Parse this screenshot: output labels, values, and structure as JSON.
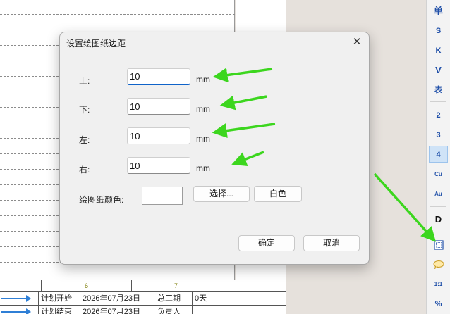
{
  "dialog": {
    "title": "设置绘图纸边距",
    "close_glyph": "✕",
    "margins": [
      {
        "label": "上:",
        "value": "10",
        "unit": "mm"
      },
      {
        "label": "下:",
        "value": "10",
        "unit": "mm"
      },
      {
        "label": "左:",
        "value": "10",
        "unit": "mm"
      },
      {
        "label": "右:",
        "value": "10",
        "unit": "mm"
      }
    ],
    "paper_color_label": "绘图纸颜色:",
    "paper_color_value": "#ffffff",
    "select_button": "选择...",
    "white_button": "白色",
    "ok_button": "确定",
    "cancel_button": "取消"
  },
  "gantt": {
    "column_numbers": [
      "6",
      "7"
    ],
    "rows": [
      {
        "label": "计划开始",
        "date": "2026年07月23日",
        "field": "总工期",
        "value": "0天"
      },
      {
        "label": "计划结束",
        "date": "2026年07月23日",
        "field": "负责人",
        "value": ""
      }
    ],
    "arrow_color": "#2f7fd6"
  },
  "toolbar": {
    "items": [
      "单",
      "S",
      "K",
      "V",
      "表",
      "2",
      "3",
      "4",
      "Cu",
      "Au",
      "D",
      "page-margin-icon",
      "comment-icon",
      "1:1",
      "%"
    ],
    "active": "4"
  },
  "annotation_color": "#3cd61e"
}
